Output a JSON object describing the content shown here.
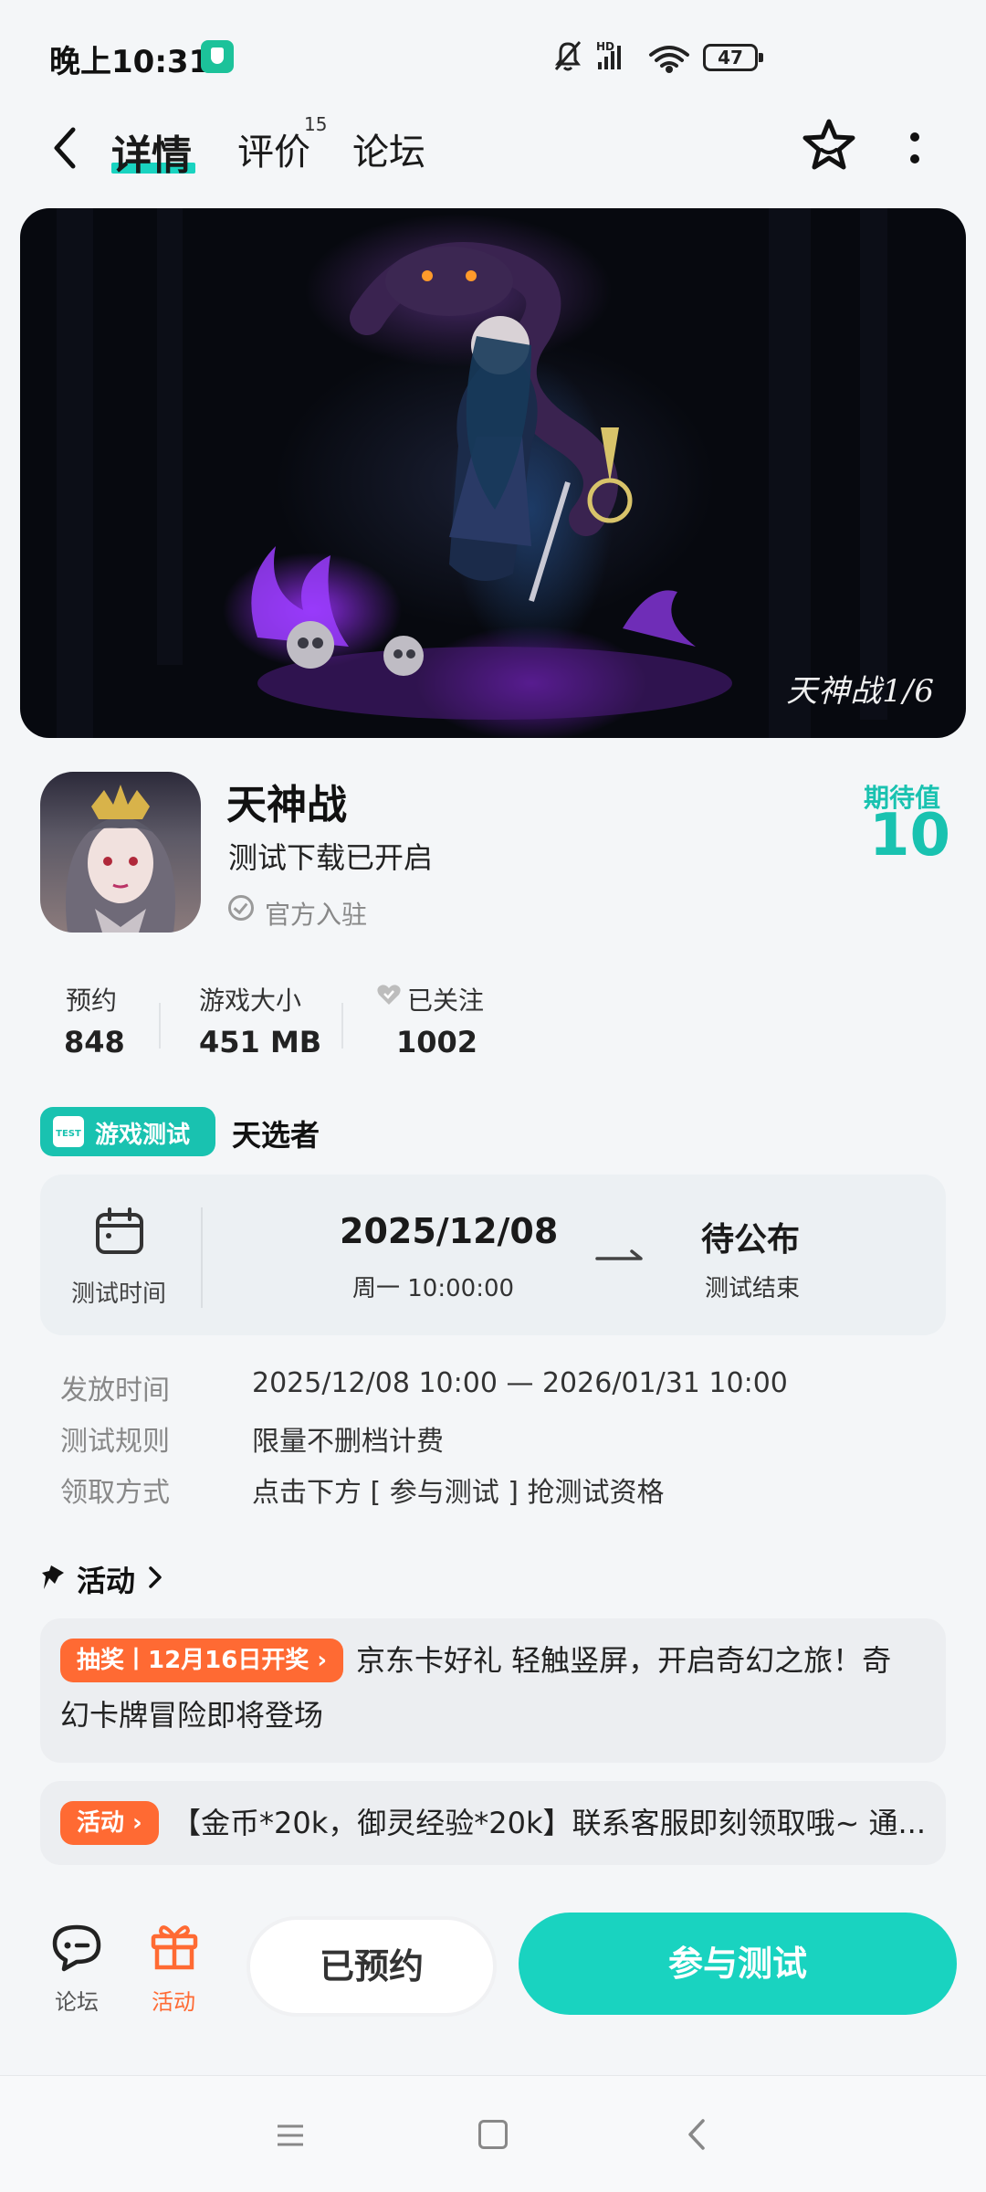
{
  "status_bar": {
    "time": "晚上10:31",
    "battery": "47",
    "icons": [
      "shield-icon",
      "mute-icon",
      "hd-signal-icon",
      "wifi-icon",
      "battery-icon"
    ]
  },
  "header": {
    "tabs": [
      {
        "label": "详情",
        "active": true
      },
      {
        "label": "评价",
        "count": "15"
      },
      {
        "label": "论坛"
      }
    ],
    "icons": [
      "back-icon",
      "star-icon",
      "more-icon"
    ]
  },
  "banner": {
    "logo_text": "天神战1/6"
  },
  "game": {
    "title": "天神战",
    "subtitle": "测试下载已开启",
    "official": "官方入驻",
    "expect_label": "期待值",
    "expect_value": "10"
  },
  "stats": [
    {
      "label": "预约",
      "value": "848"
    },
    {
      "label": "游戏大小",
      "value": "451 MB"
    },
    {
      "label": "已关注",
      "value": "1002"
    }
  ],
  "test": {
    "tag_icon_text": "TEST",
    "tag_label": "游戏测试",
    "name": "天选者",
    "time_label": "测试时间",
    "start_date": "2025/12/08",
    "start_time": "周一  10:00:00",
    "end_status": "待公布",
    "end_label": "测试结束"
  },
  "details": [
    {
      "label": "发放时间",
      "value": "2025/12/08 10:00 — 2026/01/31 10:00"
    },
    {
      "label": "测试规则",
      "value": "限量不删档计费"
    },
    {
      "label": "领取方式",
      "value": "点击下方 [ 参与测试 ] 抢测试资格"
    }
  ],
  "activity": {
    "title": "活动",
    "items": [
      {
        "badge": "抽奖丨12月16日开奖 ›",
        "text_line1": "京东卡好礼 轻触竖屏，开启奇幻之旅！奇",
        "text_line2": "幻卡牌冒险即将登场"
      },
      {
        "badge": "活动 ›",
        "text": "【金币*20k，御灵经验*20k】联系客服即刻领取哦~ 通..."
      }
    ]
  },
  "bottom_bar": {
    "forum_label": "论坛",
    "activity_label": "活动",
    "reserved_label": "已预约",
    "join_label": "参与测试"
  },
  "colors": {
    "accent": "#19d3c0",
    "accent_dark": "#19c2b0",
    "orange": "#ff6a33"
  }
}
